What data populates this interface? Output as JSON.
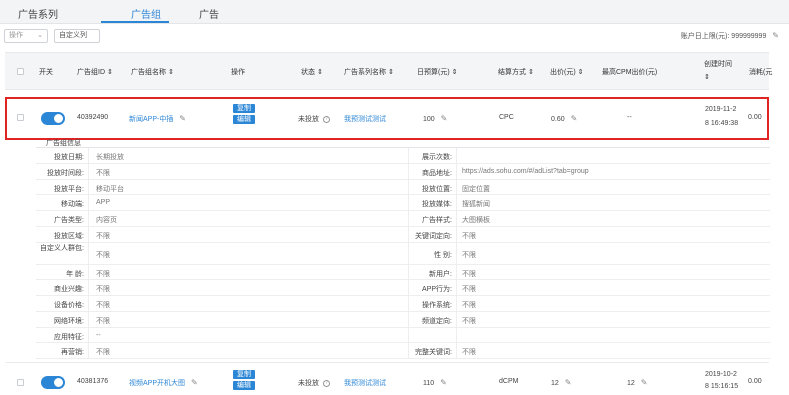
{
  "tabs": [
    "广告系列",
    "广告组",
    "广告"
  ],
  "toolbar": {
    "action_label": "操作",
    "custom_columns_label": "自定义列",
    "balance_text": "账户日上限(元): 999999999"
  },
  "table": {
    "headers": {
      "switch": "开关",
      "id": "广告组ID ⇕",
      "name": "广告组名称 ⇕",
      "operation": "操作",
      "status": "状态 ⇕",
      "campaign": "广告系列名称 ⇕",
      "budget": "日预算(元) ⇕",
      "bid_type": "结算方式 ⇕",
      "bid": "出价(元) ⇕",
      "max_cpm": "最高CPM出价(元)",
      "created_l1": "创建时间",
      "created_l2": "⇕",
      "cost": "消耗(元"
    },
    "rows": [
      {
        "id": "40392490",
        "name": "新闻APP-中插",
        "btn_copy": "复制",
        "btn_edit": "编辑",
        "status": "未投放",
        "campaign": "我预测试测试",
        "budget": "100",
        "bid_type": "CPC",
        "bid": "0.60",
        "max_cpm": "--",
        "created_l1": "2019-11-2",
        "created_l2": "8 16:49:38",
        "cost": "0.00"
      },
      {
        "id": "40381376",
        "name": "视频APP开机大图",
        "btn_copy": "复制",
        "btn_edit": "编辑",
        "status": "未投放",
        "campaign": "我预测试测试",
        "budget": "110",
        "bid_type": "dCPM",
        "bid": "12",
        "max_cpm": "12",
        "created_l1": "2019-10-2",
        "created_l2": "8 15:16:15",
        "cost": "0.00"
      }
    ]
  },
  "detail": {
    "title": "广告组信息",
    "rows": [
      {
        "l1": "投放日期:",
        "v1": "长期投放",
        "l2": "展示次数:",
        "v2": ""
      },
      {
        "l1": "投放时间段:",
        "v1": "不限",
        "l2": "商品地址:",
        "v2": "https://ads.sohu.com/#/adList?tab=group"
      },
      {
        "l1": "投放平台:",
        "v1": "移动平台",
        "l2": "投放位置:",
        "v2": "固定位置"
      },
      {
        "l1": "移动端:",
        "v1": "APP",
        "l2": "投放媒体:",
        "v2": "搜狐新闻"
      },
      {
        "l1": "广告类型:",
        "v1": "内容页",
        "l2": "广告样式:",
        "v2": "大图横板"
      },
      {
        "l1": "投放区域:",
        "v1": "不限",
        "l2": "关键词定向:",
        "v2": "不限"
      },
      {
        "l1": "自定义人群包:",
        "v1": "不限",
        "l2": "性 别:",
        "v2": "不限"
      },
      {
        "l1": "年 龄:",
        "v1": "不限",
        "l2": "新用户:",
        "v2": "不限"
      },
      {
        "l1": "商业兴趣:",
        "v1": "不限",
        "l2": "APP行为:",
        "v2": "不限"
      },
      {
        "l1": "设备价格:",
        "v1": "不限",
        "l2": "操作系统:",
        "v2": "不限"
      },
      {
        "l1": "网络环境:",
        "v1": "不限",
        "l2": "频道定向:",
        "v2": "不限"
      },
      {
        "l1": "应用特征:",
        "v1": "--",
        "l2": "",
        "v2": ""
      },
      {
        "l1": "再营销:",
        "v1": "不限",
        "l2": "完整关键词:",
        "v2": "不限"
      }
    ]
  }
}
